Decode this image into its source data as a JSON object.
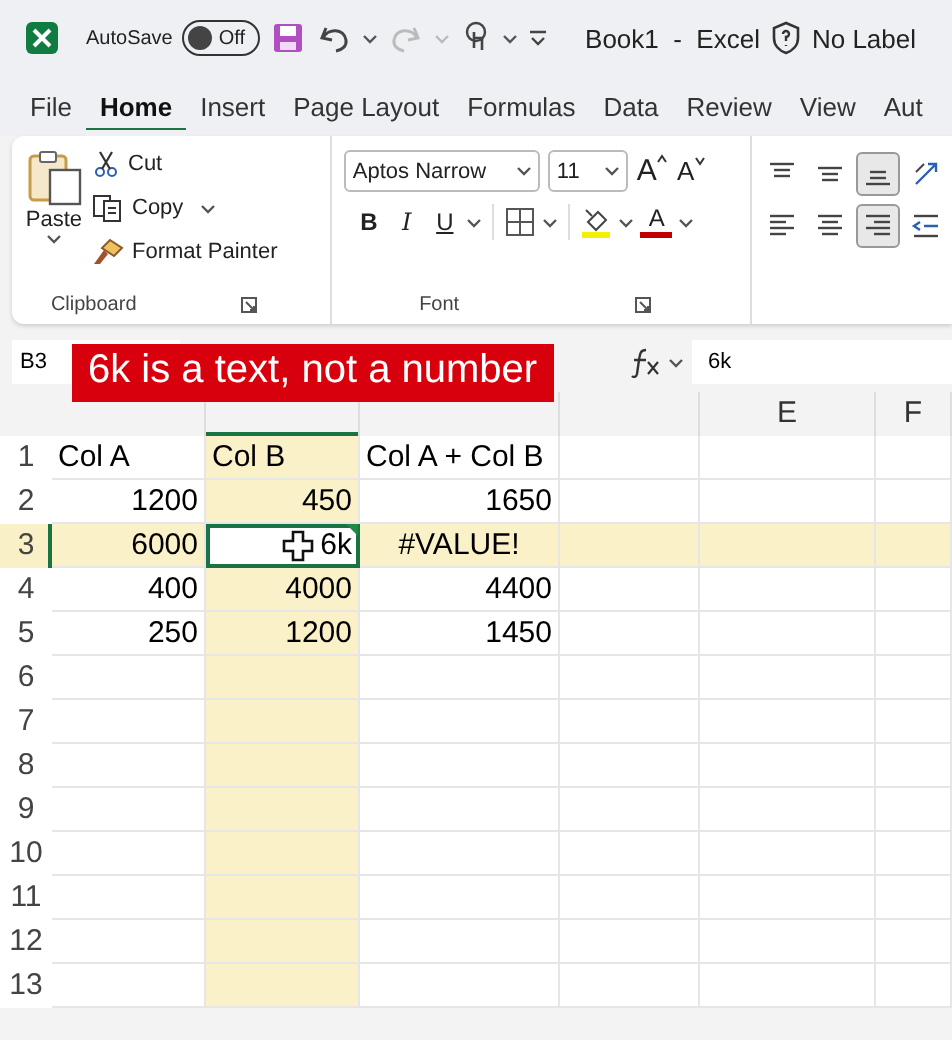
{
  "titlebar": {
    "autosave_label": "AutoSave",
    "autosave": {
      "on": false,
      "label": "Off"
    },
    "redo_disabled": true,
    "title": "Book1  -  Excel",
    "sensitivity": "No Label"
  },
  "tabs": [
    {
      "label": "File",
      "selected": false
    },
    {
      "label": "Home",
      "selected": true
    },
    {
      "label": "Insert",
      "selected": false
    },
    {
      "label": "Page Layout",
      "selected": false
    },
    {
      "label": "Formulas",
      "selected": false
    },
    {
      "label": "Data",
      "selected": false
    },
    {
      "label": "Review",
      "selected": false
    },
    {
      "label": "View",
      "selected": false
    },
    {
      "label": "Aut",
      "selected": false
    }
  ],
  "clipboard": {
    "paste": "Paste",
    "cut": "Cut",
    "copy": "Copy",
    "format_painter": "Format Painter",
    "label": "Clipboard"
  },
  "font": {
    "name": "Aptos Narrow",
    "size": "11",
    "grow": "A",
    "shrink": "A",
    "bold": "B",
    "italic": "I",
    "underline": "U",
    "font_color": "A",
    "label": "Font"
  },
  "alignment": [
    {
      "kind": "top",
      "selected": false
    },
    {
      "kind": "middle",
      "selected": false
    },
    {
      "kind": "bottom",
      "selected": true
    },
    {
      "kind": "orientation",
      "selected": false
    },
    {
      "kind": "left",
      "selected": false
    },
    {
      "kind": "center",
      "selected": false
    },
    {
      "kind": "right",
      "selected": true
    },
    {
      "kind": "indent",
      "selected": false
    }
  ],
  "formula_bar": {
    "name_box": "B3",
    "formula": "6k"
  },
  "banner": "6k is a text, not a number",
  "sheet": {
    "columns": [
      {
        "selected": false
      },
      {
        "selected": true
      },
      {
        "selected": false
      },
      {
        "selected": false
      },
      {
        "label": "E",
        "selected": false
      },
      {
        "label": "F",
        "selected": false
      }
    ],
    "rows": [
      {
        "label": "1",
        "selected": false,
        "cells": [
          {
            "value": "Col A",
            "kind": "text"
          },
          {
            "value": "Col B",
            "kind": "text"
          },
          {
            "value": "Col A + Col B",
            "kind": "text"
          }
        ]
      },
      {
        "label": "2",
        "selected": false,
        "cells": [
          {
            "value": "1200",
            "kind": "number"
          },
          {
            "value": "450",
            "kind": "number"
          },
          {
            "value": "1650",
            "kind": "number"
          }
        ]
      },
      {
        "label": "3",
        "selected": true,
        "cells": [
          {
            "value": "6000",
            "kind": "number"
          },
          {
            "value": "6k",
            "kind": "righttext",
            "active": true,
            "error_flag": true
          },
          {
            "value": "#VALUE!",
            "kind": "error"
          }
        ]
      },
      {
        "label": "4",
        "selected": false,
        "cells": [
          {
            "value": "400",
            "kind": "number"
          },
          {
            "value": "4000",
            "kind": "number"
          },
          {
            "value": "4400",
            "kind": "number"
          }
        ]
      },
      {
        "label": "5",
        "selected": false,
        "cells": [
          {
            "value": "250",
            "kind": "number"
          },
          {
            "value": "1200",
            "kind": "number"
          },
          {
            "value": "1450",
            "kind": "number"
          }
        ]
      },
      {
        "label": "6",
        "selected": false
      },
      {
        "label": "7",
        "selected": false
      },
      {
        "label": "8",
        "selected": false
      },
      {
        "label": "9",
        "selected": false
      },
      {
        "label": "10",
        "selected": false
      },
      {
        "label": "11",
        "selected": false
      },
      {
        "label": "12",
        "selected": false
      },
      {
        "label": "13",
        "selected": false
      }
    ]
  }
}
